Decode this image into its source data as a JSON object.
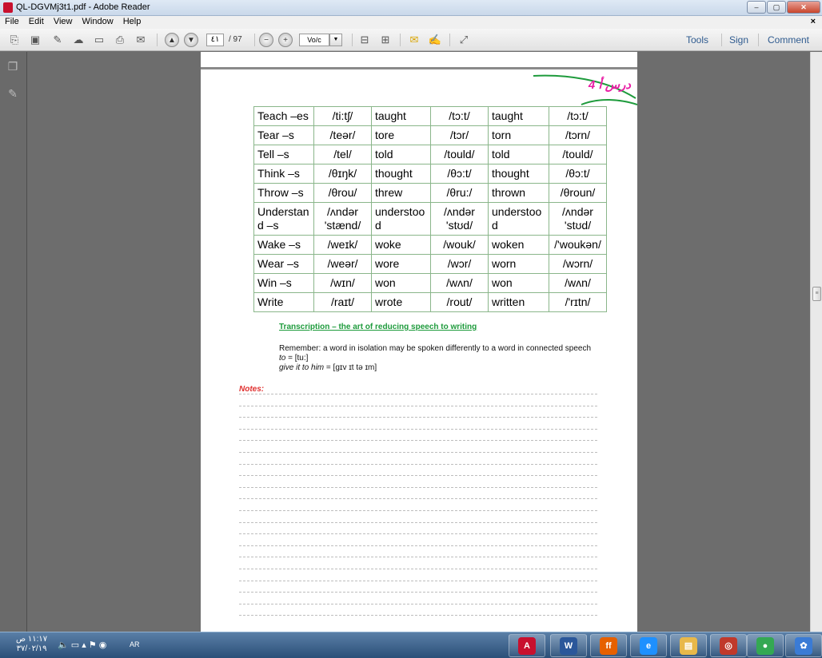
{
  "window": {
    "title": "QL-DGVMj3t1.pdf - Adobe Reader",
    "min": "–",
    "max": "▢",
    "close": "✕"
  },
  "menu": {
    "items": [
      "File",
      "Edit",
      "View",
      "Window",
      "Help"
    ],
    "close_doc": "×"
  },
  "toolbar": {
    "page_current": "٤١",
    "page_total": "/ 97",
    "zoom_value": "Vo/c",
    "tools_label": "Tools",
    "sign_label": "Sign",
    "comment_label": "Comment"
  },
  "page": {
    "lesson_tag": "4 درس أ",
    "table_rows": [
      [
        "Teach –es",
        "/ti:tʃ/",
        "taught",
        "/tɔ:t/",
        "taught",
        "/tɔ:t/"
      ],
      [
        "Tear –s",
        "/teər/",
        "tore",
        "/tɔr/",
        "torn",
        "/tɔrn/"
      ],
      [
        "Tell –s",
        "/tel/",
        "told",
        "/tould/",
        "told",
        "/tould/"
      ],
      [
        "Think –s",
        "/θɪŋk/",
        "thought",
        "/θɔ:t/",
        "thought",
        "/θɔ:t/"
      ],
      [
        "Throw –s",
        "/θrou/",
        "threw",
        "/θru:/",
        "thrown",
        "/θroun/"
      ],
      [
        "Understan d –s",
        "/ʌndər 'stænd/",
        "understoo d",
        "/ʌndər 'stʊd/",
        "understoo d",
        "/ʌndər 'stʊd/"
      ],
      [
        "Wake –s",
        "/weɪk/",
        "woke",
        "/wouk/",
        "woken",
        "/'woukən/"
      ],
      [
        "Wear –s",
        "/weər/",
        "wore",
        "/wɔr/",
        "worn",
        "/wɔrn/"
      ],
      [
        "Win –s",
        "/wɪn/",
        "won",
        "/wʌn/",
        "won",
        "/wʌn/"
      ],
      [
        "Write",
        "/raɪt/",
        "wrote",
        "/rout/",
        "written",
        "/'rɪtn/"
      ]
    ],
    "transcription_title": "Transcription – the art of reducing speech to writing",
    "remember_line": "Remember: a word in isolation may be spoken differently to a word in connected speech",
    "example1_word": "to",
    "example1_ipa": "= [tu:]",
    "example2_phrase": "give it to him",
    "example2_ipa": "= [gɪv ɪt tə ɪm]",
    "notes_label": "Notes:"
  },
  "taskbar": {
    "time": "١١:١٧ ص",
    "date": "٣٧/٠٢/١٩",
    "language": "AR",
    "apps": [
      {
        "name": "adobe-reader",
        "glyph": "A",
        "color": "#c8102e"
      },
      {
        "name": "word",
        "glyph": "W",
        "color": "#2b579a"
      },
      {
        "name": "firefox",
        "glyph": "ff",
        "color": "#e66000"
      },
      {
        "name": "internet-explorer",
        "glyph": "e",
        "color": "#1e90ff"
      },
      {
        "name": "file-explorer",
        "glyph": "▤",
        "color": "#e8b84a"
      },
      {
        "name": "app-icon",
        "glyph": "◎",
        "color": "#c0392b"
      },
      {
        "name": "chrome",
        "glyph": "●",
        "color": "#34a853"
      },
      {
        "name": "app-icon-2",
        "glyph": "✿",
        "color": "#3a7bd5"
      }
    ]
  }
}
